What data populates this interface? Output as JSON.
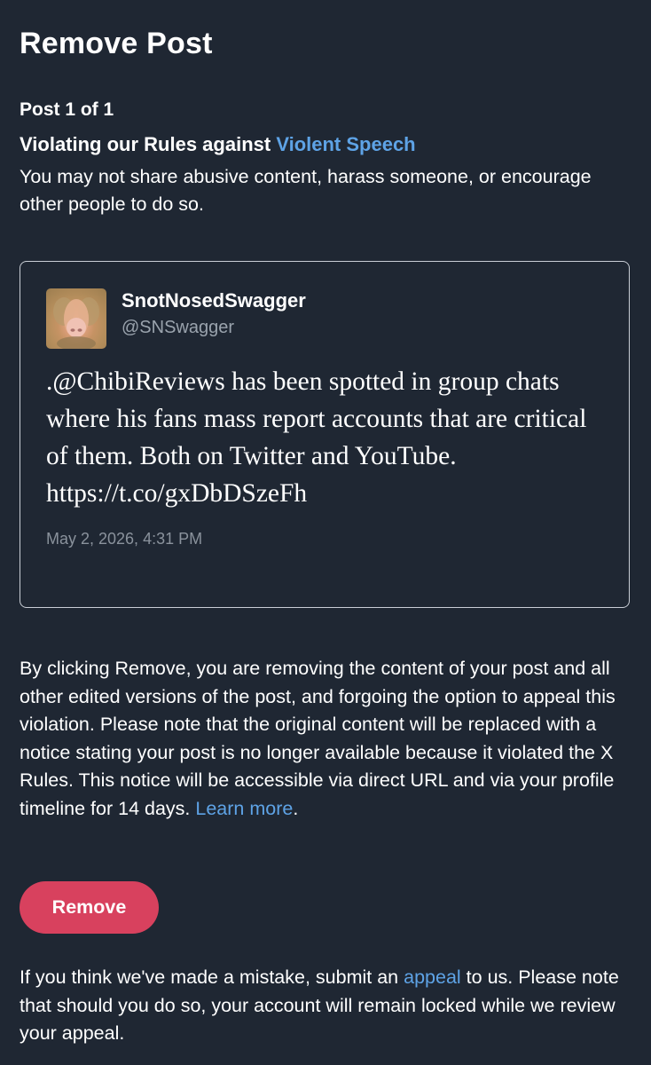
{
  "page": {
    "title": "Remove Post",
    "post_count": "Post 1 of 1"
  },
  "violation": {
    "heading_prefix": "Violating our Rules against ",
    "rule_link": "Violent Speech",
    "description": "You may not share abusive content, harass someone, or encourage other people to do so."
  },
  "post": {
    "author_name": "SnotNosedSwagger",
    "author_handle": "@SNSwagger",
    "text": ".@ChibiReviews has been spotted in group chats where his fans mass report accounts that are critical of them. Both on Twitter and YouTube. https://t.co/gxDbDSzeFh",
    "timestamp": "May 2, 2026, 4:31 PM"
  },
  "removal_notice": {
    "text": "By clicking Remove, you are removing the content of your post and all other edited versions of the post, and forgoing the option to appeal this violation. Please note that the original content will be replaced with a notice stating your post is no longer available because it violated the X Rules. This notice will be accessible via direct URL and via your profile timeline for 14 days. ",
    "learn_more": "Learn more",
    "end_punct": "."
  },
  "actions": {
    "remove_label": "Remove"
  },
  "appeal": {
    "text_before": "If you think we've made a mistake, submit an ",
    "link": "appeal",
    "text_after": " to us. Please note that should you do so, your account will remain locked while we review your appeal."
  },
  "colors": {
    "background": "#1f2733",
    "link": "#5ea3e6",
    "button": "#d8415e",
    "card_border": "#c9ced6"
  }
}
